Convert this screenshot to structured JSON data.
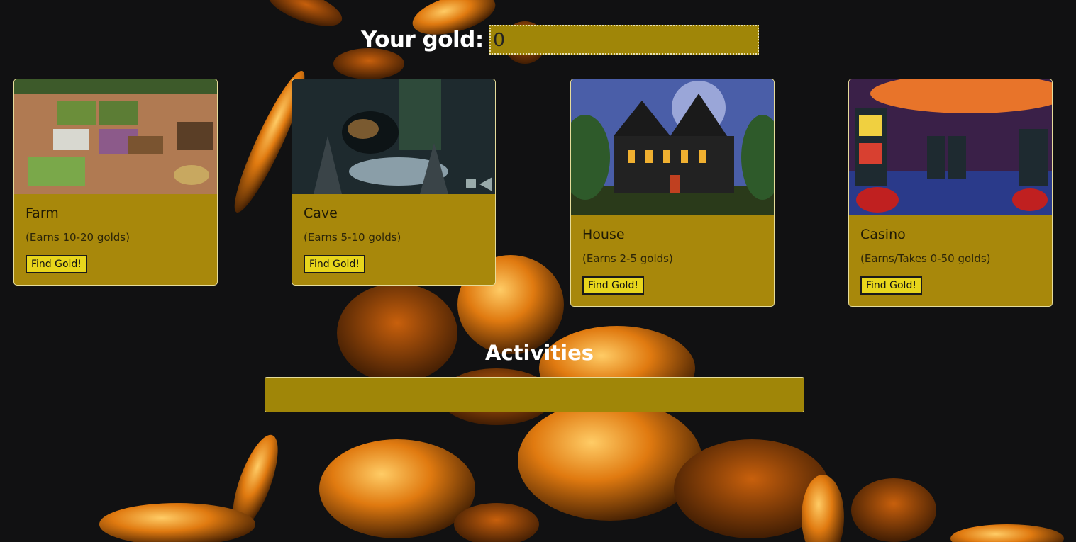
{
  "gold": {
    "label": "Your gold:",
    "value": "0"
  },
  "cards": [
    {
      "title": "Farm",
      "desc": "(Earns 10-20 golds)",
      "button": "Find Gold!"
    },
    {
      "title": "Cave",
      "desc": "(Earns 5-10 golds)",
      "button": "Find Gold!"
    },
    {
      "title": "House",
      "desc": "(Earns 2-5 golds)",
      "button": "Find Gold!"
    },
    {
      "title": "Casino",
      "desc": "(Earns/Takes 0-50 golds)",
      "button": "Find Gold!"
    }
  ],
  "activities": {
    "title": "Activities",
    "log": ""
  },
  "colors": {
    "background": "#111112",
    "card": "#a8880b",
    "button": "#e8d61c",
    "coin": "#e07a10"
  }
}
